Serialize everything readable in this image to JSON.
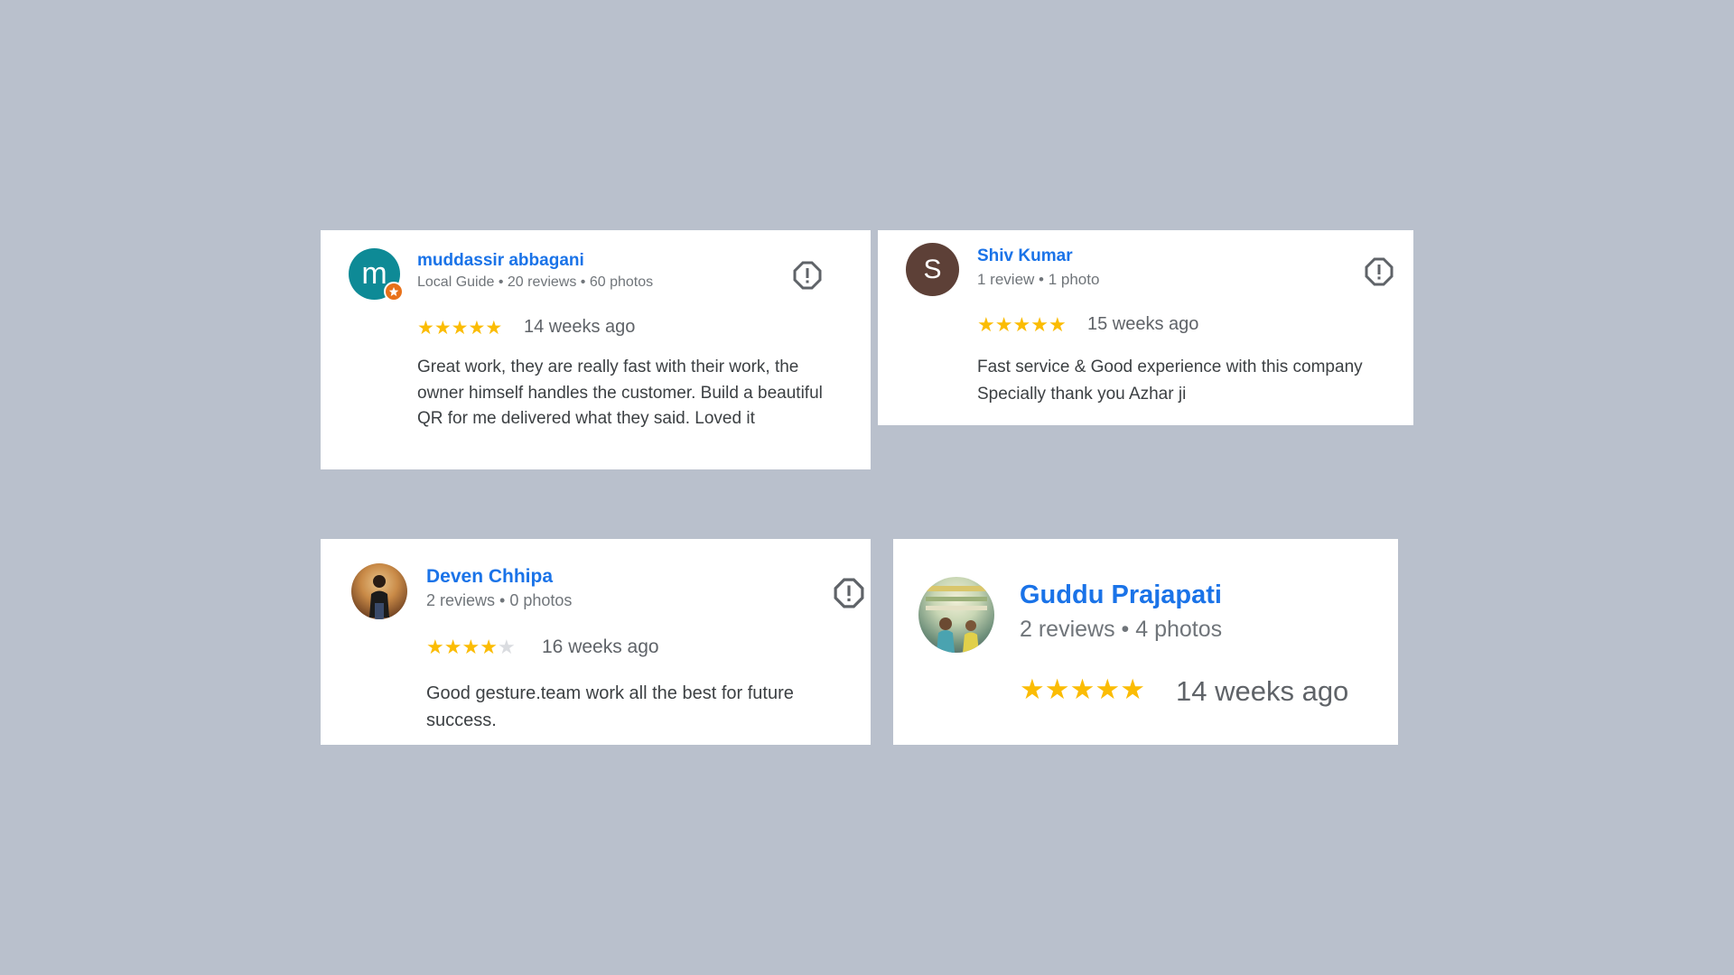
{
  "colors": {
    "background": "#b9c0cc",
    "name": "#1a73e8",
    "star_filled": "#fbbc04",
    "star_empty": "#dadce0",
    "local_guide_badge": "#e8711a"
  },
  "reviews": [
    {
      "reviewer": "muddassir abbagani",
      "avatar_letter": "m",
      "avatar_color": "#0e8a96",
      "local_guide_badge_icon": "star-icon",
      "meta": "Local Guide • 20 reviews • 60 photos",
      "rating": 5,
      "time": "14 weeks ago",
      "text": "Great work, they are really fast with their work, the owner himself handles the customer. Build a beautiful QR for me delivered what they said. Loved it",
      "report_icon": "report-flag-icon"
    },
    {
      "reviewer": "Shiv Kumar",
      "avatar_letter": "S",
      "avatar_color": "#5d4037",
      "meta": "1 review • 1 photo",
      "rating": 5,
      "time": "15 weeks ago",
      "text": "Fast service & Good experience with this company Specially thank you Azhar ji",
      "report_icon": "report-flag-icon"
    },
    {
      "reviewer": "Deven Chhipa",
      "avatar_icon": "profile-photo",
      "meta": "2 reviews • 0 photos",
      "rating": 4,
      "time": "16 weeks ago",
      "text": "Good gesture.team work all the best for future success.",
      "report_icon": "report-flag-icon"
    },
    {
      "reviewer": "Guddu Prajapati",
      "avatar_icon": "profile-photo",
      "meta": "2 reviews • 4 photos",
      "rating": 5,
      "time": "14 weeks ago"
    }
  ]
}
